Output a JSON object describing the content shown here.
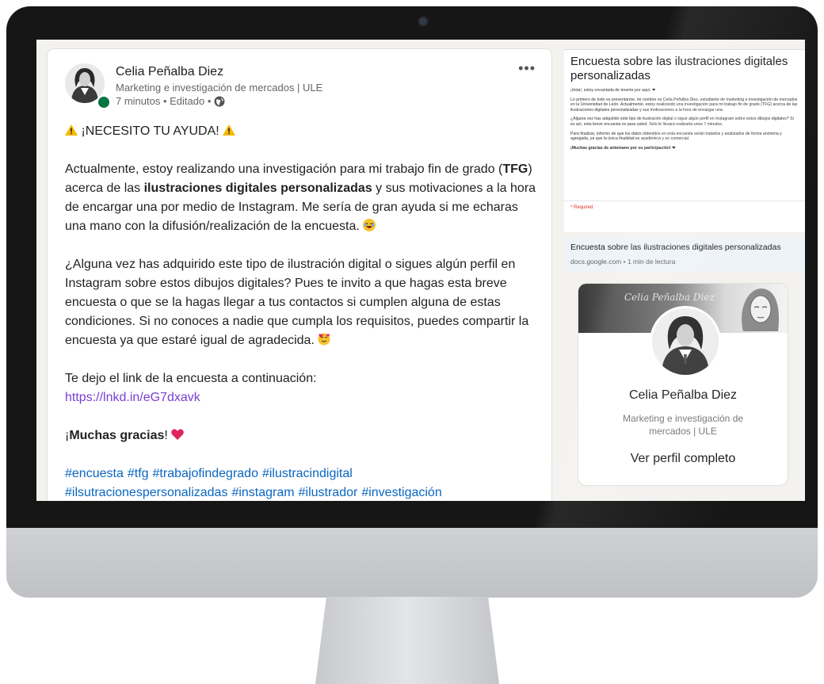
{
  "post": {
    "author_name": "Celia Peñalba Diez",
    "author_headline": "Marketing e investigación de mercados | ULE",
    "meta_time": "7 minutos • Editado •",
    "menu_label": "•••",
    "alert_text": "¡NECESITO TU AYUDA!",
    "p1_a": "Actualmente, estoy realizando una investigación para mi trabajo fin de grado (",
    "p1_tfg": "TFG",
    "p1_b": ") acerca de las ",
    "p1_bold": "ilustraciones digitales personalizadas",
    "p1_c": " y sus motivaciones a la hora de encargar una por medio de Instagram. Me sería de gran ayuda si me echaras una mano con la difusión/realización de la encuesta.",
    "p2": "¿Alguna vez has adquirido este tipo de ilustración digital o sigues algún perfil en Instagram sobre estos dibujos digitales? Pues te invito a que hagas esta breve encuesta o que se la hagas llegar a tus contactos si cumplen alguna de estas condiciones. Si no conoces a nadie que cumpla los requisitos, puedes compartir la encuesta ya que estaré igual de agradecida.",
    "link_intro": "Te dejo el link de la encuesta a continuación:",
    "link_url": "https://lnkd.in/eG7dxavk",
    "thanks_pre": "¡",
    "thanks_bold": "Muchas gracias",
    "thanks_post": "!",
    "hashtags": [
      "#encuesta",
      "#tfg",
      "#trabajofindegrado",
      "#ilustracindigital",
      "#ilsutracionespersonalizadas",
      "#instagram",
      "#ilustrador",
      "#investigación"
    ]
  },
  "form": {
    "title": "Encuesta sobre las ilustraciones digitales personalizadas",
    "greeting": "¡Hola!, estoy encantada de tenerte por aquí. ❤",
    "para1": "Lo primero de todo es presentarme, mi nombre es Celia Peñalba Diez, estudiante de marketing e investigación de mercados en la Universidad de León. Actualmente, estoy realizando una investigación para mi trabajo fin de grado (TFG) acerca de las ilustraciones digitales personalizadas y sus motivaciones a la hora de encargar una.",
    "para2": "¿Alguna vez has adquirido este tipo de ilustración digital o sigue algún perfil en Instagram sobre estos dibujos digitales? Si es así, esta breve encuesta es para usted. Solo le llevará realizarla unos 7 minutos.",
    "para3": "Para finalizar, informo de que los datos obtenidos en esta encuesta serán tratados y analizados de forma anónima y agregada, ya que la única finalidad es académica y no comercial.",
    "closing": "¡Muchas gracias de antemano por su participación! ❤",
    "required": "* Required"
  },
  "link_card": {
    "title": "Encuesta sobre las ilustraciones digitales personalizadas",
    "subtitle": "docs.google.com • 1 min de lectura"
  },
  "profile_card": {
    "banner_text": "Celia Peñalba Diez",
    "name": "Celia Peñalba Diez",
    "headline": "Marketing e investigación de mercados | ULE",
    "cta": "Ver perfil completo"
  },
  "colors": {
    "link_purple": "#7a3fd1",
    "hashtag_blue": "#0a66c2",
    "presence_green": "#057642",
    "warning_yellow": "#f5b800",
    "heart_red": "#e0245e"
  },
  "icons": [
    "warning-icon",
    "globe-icon",
    "more-icon",
    "heart-icon",
    "laughing-emoji-icon",
    "hug-emoji-icon"
  ]
}
